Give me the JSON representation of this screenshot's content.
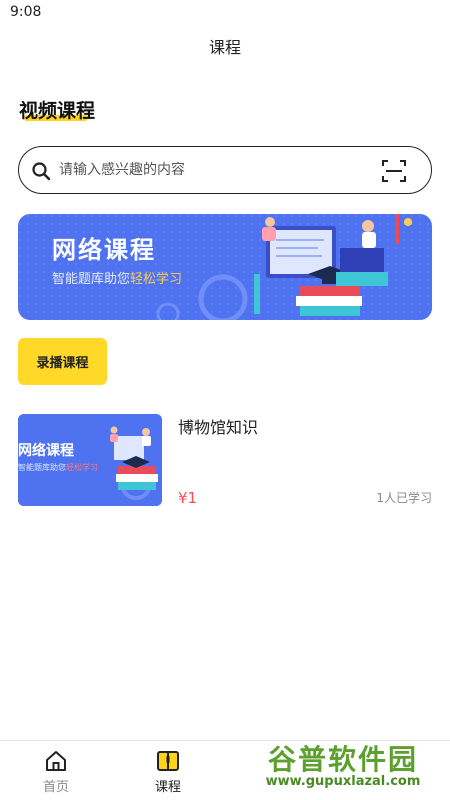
{
  "status_bar": {
    "time": "9:08"
  },
  "header": {
    "title": "课程"
  },
  "section": {
    "title": "视频课程"
  },
  "search": {
    "placeholder": "请输入感兴趣的内容"
  },
  "banner": {
    "title": "网络课程",
    "subtitle_prefix": "智能题库助您",
    "subtitle_highlight": "轻松学习"
  },
  "filter": {
    "recorded_label": "录播课程"
  },
  "courses": [
    {
      "thumb_title": "网络课程",
      "thumb_subtitle_prefix": "智能题库助您",
      "thumb_subtitle_highlight": "轻松学习",
      "name": "博物馆知识",
      "price": "¥1",
      "learners": "1人已学习"
    }
  ],
  "tabbar": {
    "items": [
      {
        "label": "首页",
        "icon": "home-icon",
        "active": false
      },
      {
        "label": "课程",
        "icon": "book-icon",
        "active": true
      }
    ]
  },
  "watermark": {
    "text": "谷普软件园",
    "url": "www.gupuxlazal.com"
  },
  "colors": {
    "accent_yellow": "#ffd828",
    "banner_blue": "#4f73f0",
    "price_red": "#ff4d4f"
  }
}
